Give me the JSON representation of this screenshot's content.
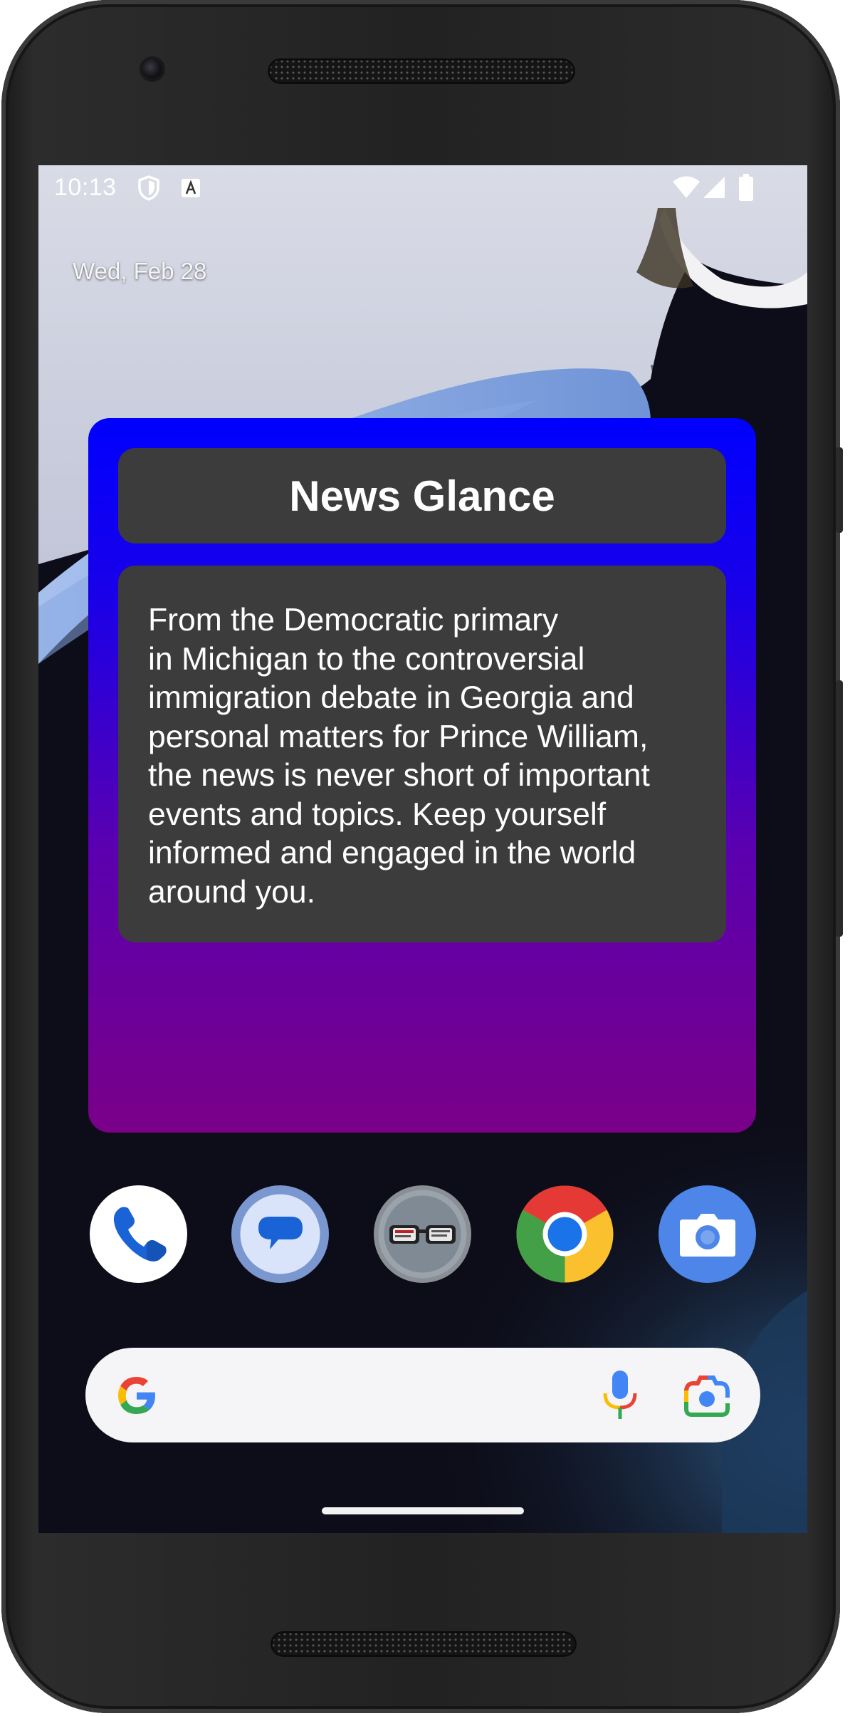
{
  "status_bar": {
    "time": "10:13",
    "icons": [
      "shield-icon",
      "text-a-icon",
      "wifi-icon",
      "signal-icon",
      "battery-icon"
    ]
  },
  "home": {
    "date": "Wed, Feb 28"
  },
  "widget": {
    "title": "News Glance",
    "body": " From the Democratic primary\nin Michigan to the controversial\nimmigration debate in Georgia and\npersonal matters for Prince William,\nthe news is never short of important\nevents and topics. Keep yourself\ninformed and engaged in the world\naround you.",
    "gradient_top": "#0000ff",
    "gradient_bottom": "#7a0088",
    "box_color": "#3c3c3c"
  },
  "dock": {
    "apps": [
      {
        "name": "Phone",
        "icon": "phone-icon"
      },
      {
        "name": "Messages",
        "icon": "messages-icon"
      },
      {
        "name": "News",
        "icon": "news-glasses-icon"
      },
      {
        "name": "Chrome",
        "icon": "chrome-icon"
      },
      {
        "name": "Camera",
        "icon": "camera-icon"
      }
    ]
  },
  "search_bar": {
    "icons": [
      "google-g-icon",
      "microphone-icon",
      "google-lens-icon"
    ]
  }
}
